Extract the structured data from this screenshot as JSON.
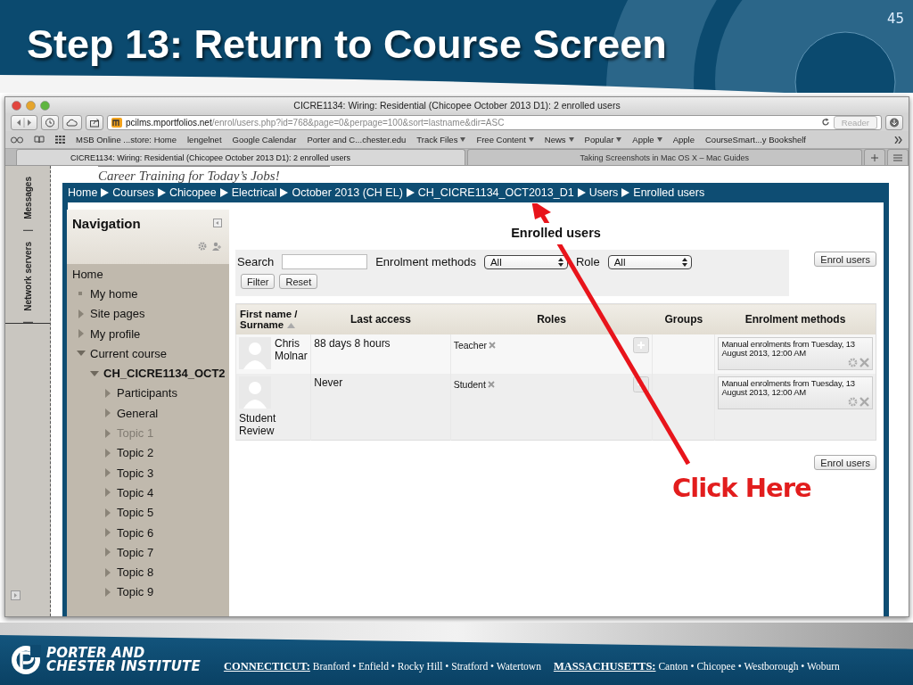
{
  "slide": {
    "title": "Step 13: Return to Course Screen",
    "page_number": "45"
  },
  "browser": {
    "window_title": "CICRE1134: Wiring: Residential (Chicopee October 2013 D1): 2 enrolled users",
    "url_host": "pcilms.mportfolios.net",
    "url_path": "/enrol/users.php?id=768&page=0&perpage=100&sort=lastname&dir=ASC",
    "reader_button": "Reader",
    "bookmarks": [
      {
        "label": "MSB Online ...store: Home",
        "menu": false
      },
      {
        "label": "lengelnet",
        "menu": false
      },
      {
        "label": "Google Calendar",
        "menu": false
      },
      {
        "label": "Porter and C...chester.edu",
        "menu": false
      },
      {
        "label": "Track Files",
        "menu": true
      },
      {
        "label": "Free Content",
        "menu": true
      },
      {
        "label": "News",
        "menu": true
      },
      {
        "label": "Popular",
        "menu": true
      },
      {
        "label": "Apple",
        "menu": true
      },
      {
        "label": "Apple",
        "menu": false
      },
      {
        "label": "CourseSmart...y Bookshelf",
        "menu": false
      }
    ],
    "tabs": [
      {
        "label": "CICRE1134: Wiring: Residential (Chicopee October 2013 D1): 2 enrolled users",
        "selected": true
      },
      {
        "label": "Taking Screenshots in Mac OS X – Mac Guides",
        "selected": false
      }
    ]
  },
  "dock": [
    "Messages",
    "Network servers"
  ],
  "page": {
    "tagline": "Career Training for Today’s Jobs!",
    "breadcrumb": [
      "Home",
      "Courses",
      "Chicopee",
      "Electrical",
      "October 2013 (CH EL)",
      "CH_CICRE1134_OCT2013_D1",
      "Users",
      "Enrolled users"
    ],
    "navigation": {
      "title": "Navigation",
      "items": [
        {
          "label": "Home",
          "kind": "link",
          "children": [
            {
              "label": "My home",
              "kind": "leaf"
            },
            {
              "label": "Site pages",
              "kind": "branch",
              "expanded": false
            },
            {
              "label": "My profile",
              "kind": "branch",
              "expanded": false
            },
            {
              "label": "Current course",
              "kind": "branch",
              "expanded": true,
              "children": [
                {
                  "label": "CH_CICRE1134_OCT2",
                  "kind": "course",
                  "expanded": true,
                  "children": [
                    {
                      "label": "Participants",
                      "kind": "branch",
                      "expanded": false,
                      "disabled": false
                    },
                    {
                      "label": "General",
                      "kind": "branch",
                      "expanded": false,
                      "disabled": false
                    },
                    {
                      "label": "Topic 1",
                      "kind": "branch",
                      "expanded": false,
                      "disabled": true
                    },
                    {
                      "label": "Topic 2",
                      "kind": "branch",
                      "expanded": false,
                      "disabled": false
                    },
                    {
                      "label": "Topic 3",
                      "kind": "branch",
                      "expanded": false,
                      "disabled": false
                    },
                    {
                      "label": "Topic 4",
                      "kind": "branch",
                      "expanded": false,
                      "disabled": false
                    },
                    {
                      "label": "Topic 5",
                      "kind": "branch",
                      "expanded": false,
                      "disabled": false
                    },
                    {
                      "label": "Topic 6",
                      "kind": "branch",
                      "expanded": false,
                      "disabled": false
                    },
                    {
                      "label": "Topic 7",
                      "kind": "branch",
                      "expanded": false,
                      "disabled": false
                    },
                    {
                      "label": "Topic 8",
                      "kind": "branch",
                      "expanded": false,
                      "disabled": false
                    },
                    {
                      "label": "Topic 9",
                      "kind": "branch",
                      "expanded": false,
                      "disabled": false
                    }
                  ]
                }
              ]
            }
          ]
        }
      ]
    },
    "heading": "Enrolled users",
    "filter": {
      "search_label": "Search",
      "methods_label": "Enrolment methods",
      "methods_value": "All",
      "role_label": "Role",
      "role_value": "All",
      "buttons": [
        "Filter",
        "Reset"
      ]
    },
    "enrol_button_top": "Enrol users",
    "table": {
      "columns": [
        {
          "label": "First name / Surname",
          "sorted": true
        },
        {
          "label": "Last access",
          "sorted": false
        },
        {
          "label": "Roles",
          "sorted": false
        },
        {
          "label": "Groups",
          "sorted": false
        },
        {
          "label": "Enrolment methods",
          "sorted": false
        }
      ],
      "rows": [
        {
          "name": "Chris Molnar",
          "last_access": "88 days 8 hours",
          "role": "Teacher",
          "enrolment": "Manual enrolments from Tuesday, 13 August 2013, 12:00 AM"
        },
        {
          "name": "Student Review",
          "last_access": "Never",
          "role": "Student",
          "enrolment": "Manual enrolments from Tuesday, 13 August 2013, 12:00 AM"
        }
      ]
    },
    "enrol_button_bottom": "Enrol users"
  },
  "annotation": "Click Here",
  "footer": {
    "logo_lines": [
      "PORTER AND",
      "CHESTER INSTITUTE"
    ],
    "regions": [
      {
        "name": "CONNECTICUT:",
        "places": "Branford • Enfield • Rocky Hill • Stratford • Watertown"
      },
      {
        "name": "MASSACHUSETTS:",
        "places": "Canton • Chicopee • Westborough • Woburn"
      }
    ]
  }
}
